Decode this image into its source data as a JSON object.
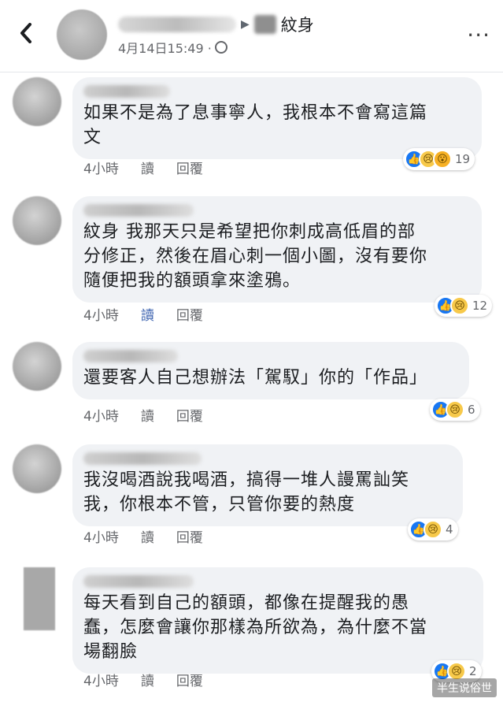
{
  "header": {
    "name_suffix": "紋身",
    "timestamp": "4月14日15:49 ·"
  },
  "comments": [
    {
      "text": "如果不是為了息事寧人，我根本不會寫這篇\n文",
      "time": "4小時",
      "read_label": "讀",
      "reply_label": "回覆",
      "reaction_count": "19"
    },
    {
      "text": "紋身 我那天只是希望把你刺成高低眉的部\n分修正，然後在眉心刺一個小圖，沒有要你\n隨便把我的額頭拿來塗鴉。",
      "time": "4小時",
      "read_label": "讀",
      "reply_label": "回覆",
      "reaction_count": "12"
    },
    {
      "text": "還要客人自己想辦法「駕馭」你的「作品」",
      "time": "4小時",
      "read_label": "讀",
      "reply_label": "回覆",
      "reaction_count": "6"
    },
    {
      "text": "我沒喝酒說我喝酒，搞得一堆人謾罵訕笑\n我，你根本不管，只管你要的熱度",
      "time": "4小時",
      "read_label": "讀",
      "reply_label": "回覆",
      "reaction_count": "4"
    },
    {
      "text": "每天看到自己的額頭，都像在提醒我的愚\n蠢，怎麼會讓你那樣為所欲為，為什麼不當\n場翻臉",
      "time": "4小時",
      "read_label": "讀",
      "reply_label": "回覆",
      "reaction_count": "2"
    }
  ],
  "watermark": "半生说俗世",
  "colors": {
    "bubble": "#f0f2f5",
    "like": "#1877f2",
    "sad": "#f7c94a",
    "meta_text": "#65676b"
  },
  "icons": [
    "back-arrow-icon",
    "globe-icon",
    "more-options-icon",
    "like-reaction-icon",
    "sad-reaction-icon",
    "wow-reaction-icon"
  ]
}
